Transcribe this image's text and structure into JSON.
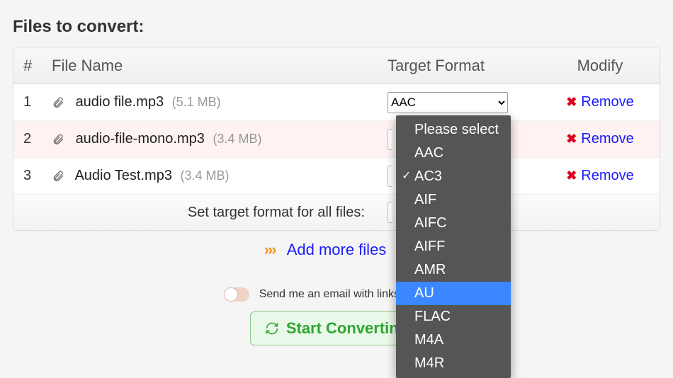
{
  "heading": "Files to convert:",
  "columns": {
    "num": "#",
    "name": "File Name",
    "fmt": "Target Format",
    "mod": "Modify"
  },
  "files": [
    {
      "num": "1",
      "name": "audio file.mp3",
      "size": "(5.1 MB)",
      "format": "AAC"
    },
    {
      "num": "2",
      "name": "audio-file-mono.mp3",
      "size": "(3.4 MB)",
      "format": ""
    },
    {
      "num": "3",
      "name": "Audio Test.mp3",
      "size": "(3.4 MB)",
      "format": ""
    }
  ],
  "remove_label": "Remove",
  "set_all_label": "Set target format for all files:",
  "add_more_label": "Add more files",
  "email_label": "Send me an email with links to conver",
  "start_label": "Start Converting",
  "dropdown": {
    "placeholder": "Please select",
    "options": [
      "AAC",
      "AC3",
      "AIF",
      "AIFC",
      "AIFF",
      "AMR",
      "AU",
      "FLAC",
      "M4A",
      "M4R"
    ],
    "checked": "AC3",
    "highlighted": "AU"
  },
  "chart_data": {
    "type": "table"
  }
}
